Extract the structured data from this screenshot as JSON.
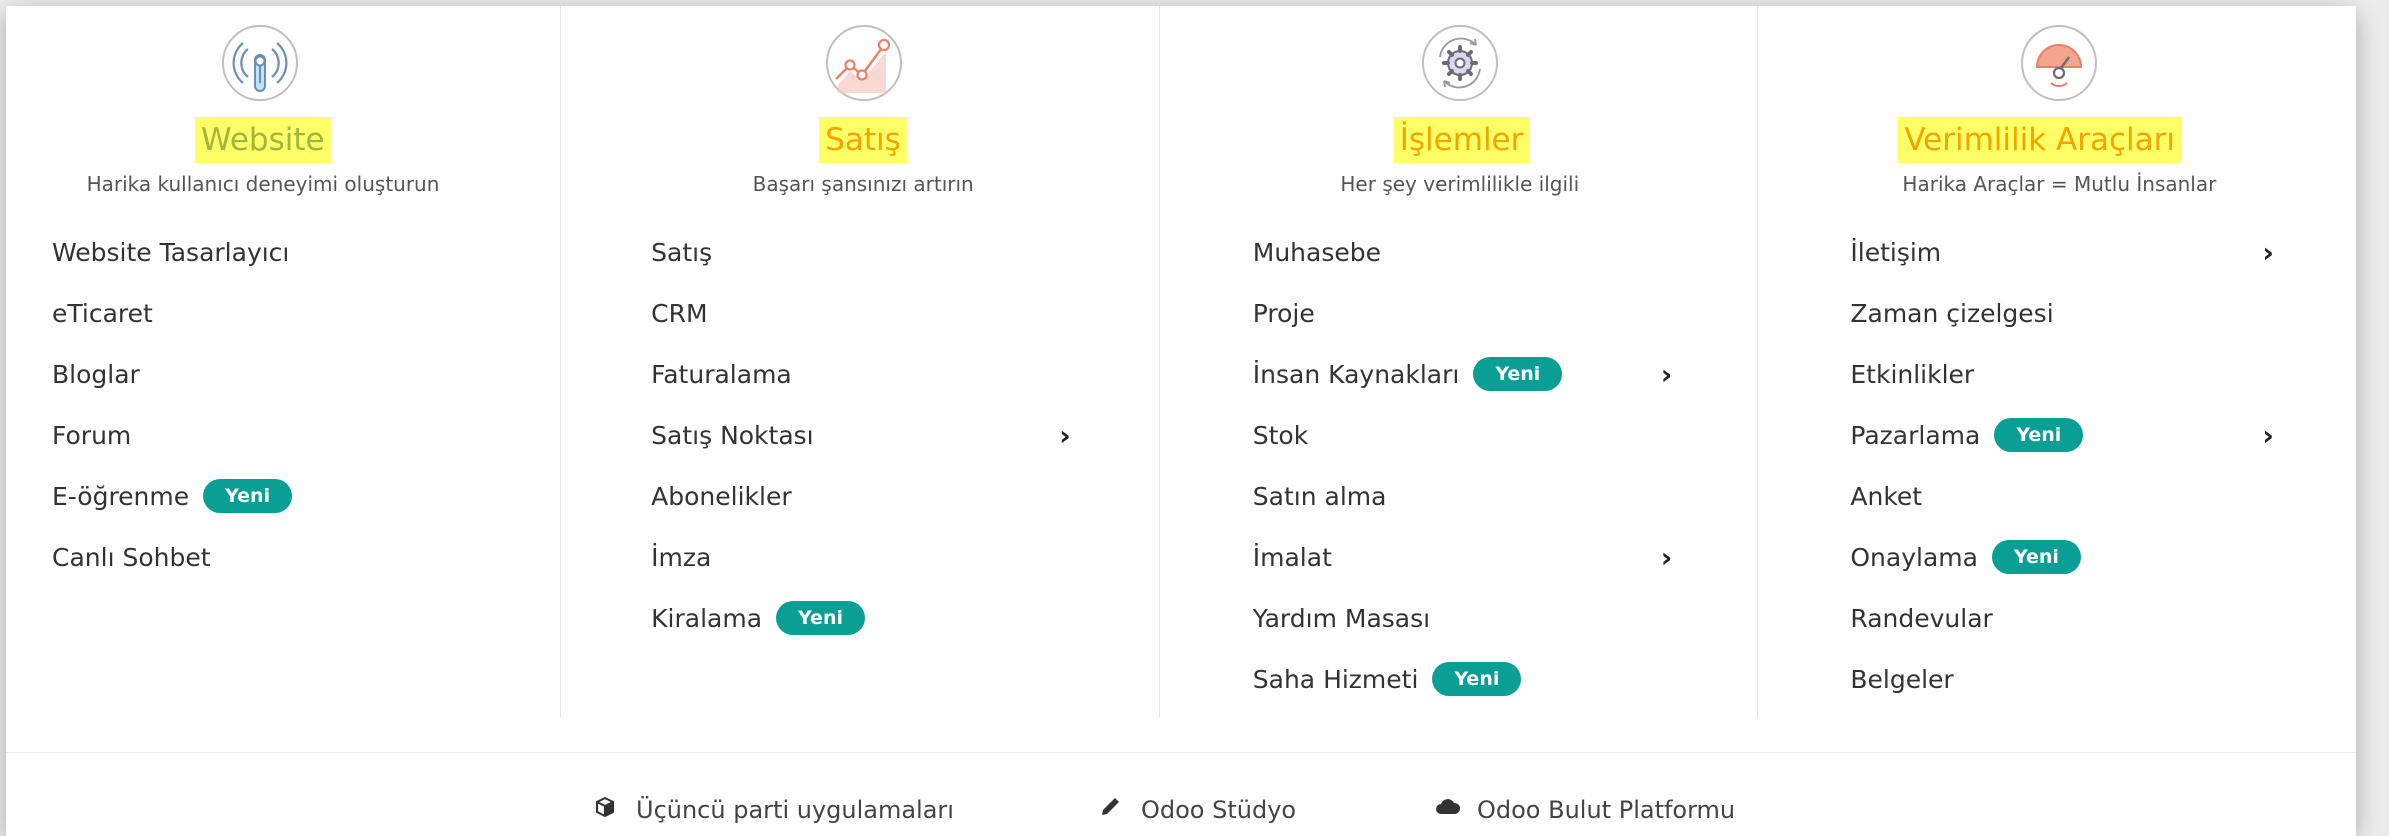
{
  "columns": [
    {
      "title": "Website",
      "subtitle": "Harika kullanıcı deneyimi oluşturun",
      "icon": "wifi-signal-icon",
      "items": [
        {
          "label": "Website Tasarlayıcı"
        },
        {
          "label": "eTicaret"
        },
        {
          "label": "Bloglar"
        },
        {
          "label": "Forum"
        },
        {
          "label": "E-öğrenme",
          "badge": "Yeni"
        },
        {
          "label": "Canlı Sohbet"
        }
      ]
    },
    {
      "title": "Satış",
      "subtitle": "Başarı şansınızı artırın",
      "icon": "growth-chart-icon",
      "items": [
        {
          "label": "Satış"
        },
        {
          "label": "CRM"
        },
        {
          "label": "Faturalama"
        },
        {
          "label": "Satış Noktası",
          "has_submenu": true
        },
        {
          "label": "Abonelikler"
        },
        {
          "label": "İmza"
        },
        {
          "label": "Kiralama",
          "badge": "Yeni"
        }
      ]
    },
    {
      "title": "İşlemler",
      "subtitle": "Her şey verimlilikle ilgili",
      "icon": "gear-icon",
      "items": [
        {
          "label": "Muhasebe"
        },
        {
          "label": "Proje"
        },
        {
          "label": "İnsan Kaynakları",
          "badge": "Yeni",
          "has_submenu": true
        },
        {
          "label": "Stok"
        },
        {
          "label": "Satın alma"
        },
        {
          "label": "İmalat",
          "has_submenu": true
        },
        {
          "label": "Yardım Masası"
        },
        {
          "label": "Saha Hizmeti",
          "badge": "Yeni"
        }
      ]
    },
    {
      "title": "Verimlilik Araçları",
      "subtitle": "Harika Araçlar = Mutlu İnsanlar",
      "icon": "speedometer-icon",
      "items": [
        {
          "label": "İletişim",
          "has_submenu": true
        },
        {
          "label": "Zaman çizelgesi"
        },
        {
          "label": "Etkinlikler"
        },
        {
          "label": "Pazarlama",
          "badge": "Yeni",
          "has_submenu": true
        },
        {
          "label": "Anket"
        },
        {
          "label": "Onaylama",
          "badge": "Yeni"
        },
        {
          "label": "Randevular"
        },
        {
          "label": "Belgeler"
        }
      ]
    }
  ],
  "footer": {
    "links": [
      {
        "label": "Üçüncü parti uygulamaları",
        "icon": "cube-icon"
      },
      {
        "label": "Odoo Stüdyo",
        "icon": "pencil-icon"
      },
      {
        "label": "Odoo Bulut Platformu",
        "icon": "cloud-icon"
      }
    ]
  },
  "colors": {
    "title_highlight": "#ffff66",
    "title_orange": "#f0a500",
    "title_green": "#a2b53c",
    "badge": "#0a9f95",
    "icon_accent": "#e8806a"
  }
}
